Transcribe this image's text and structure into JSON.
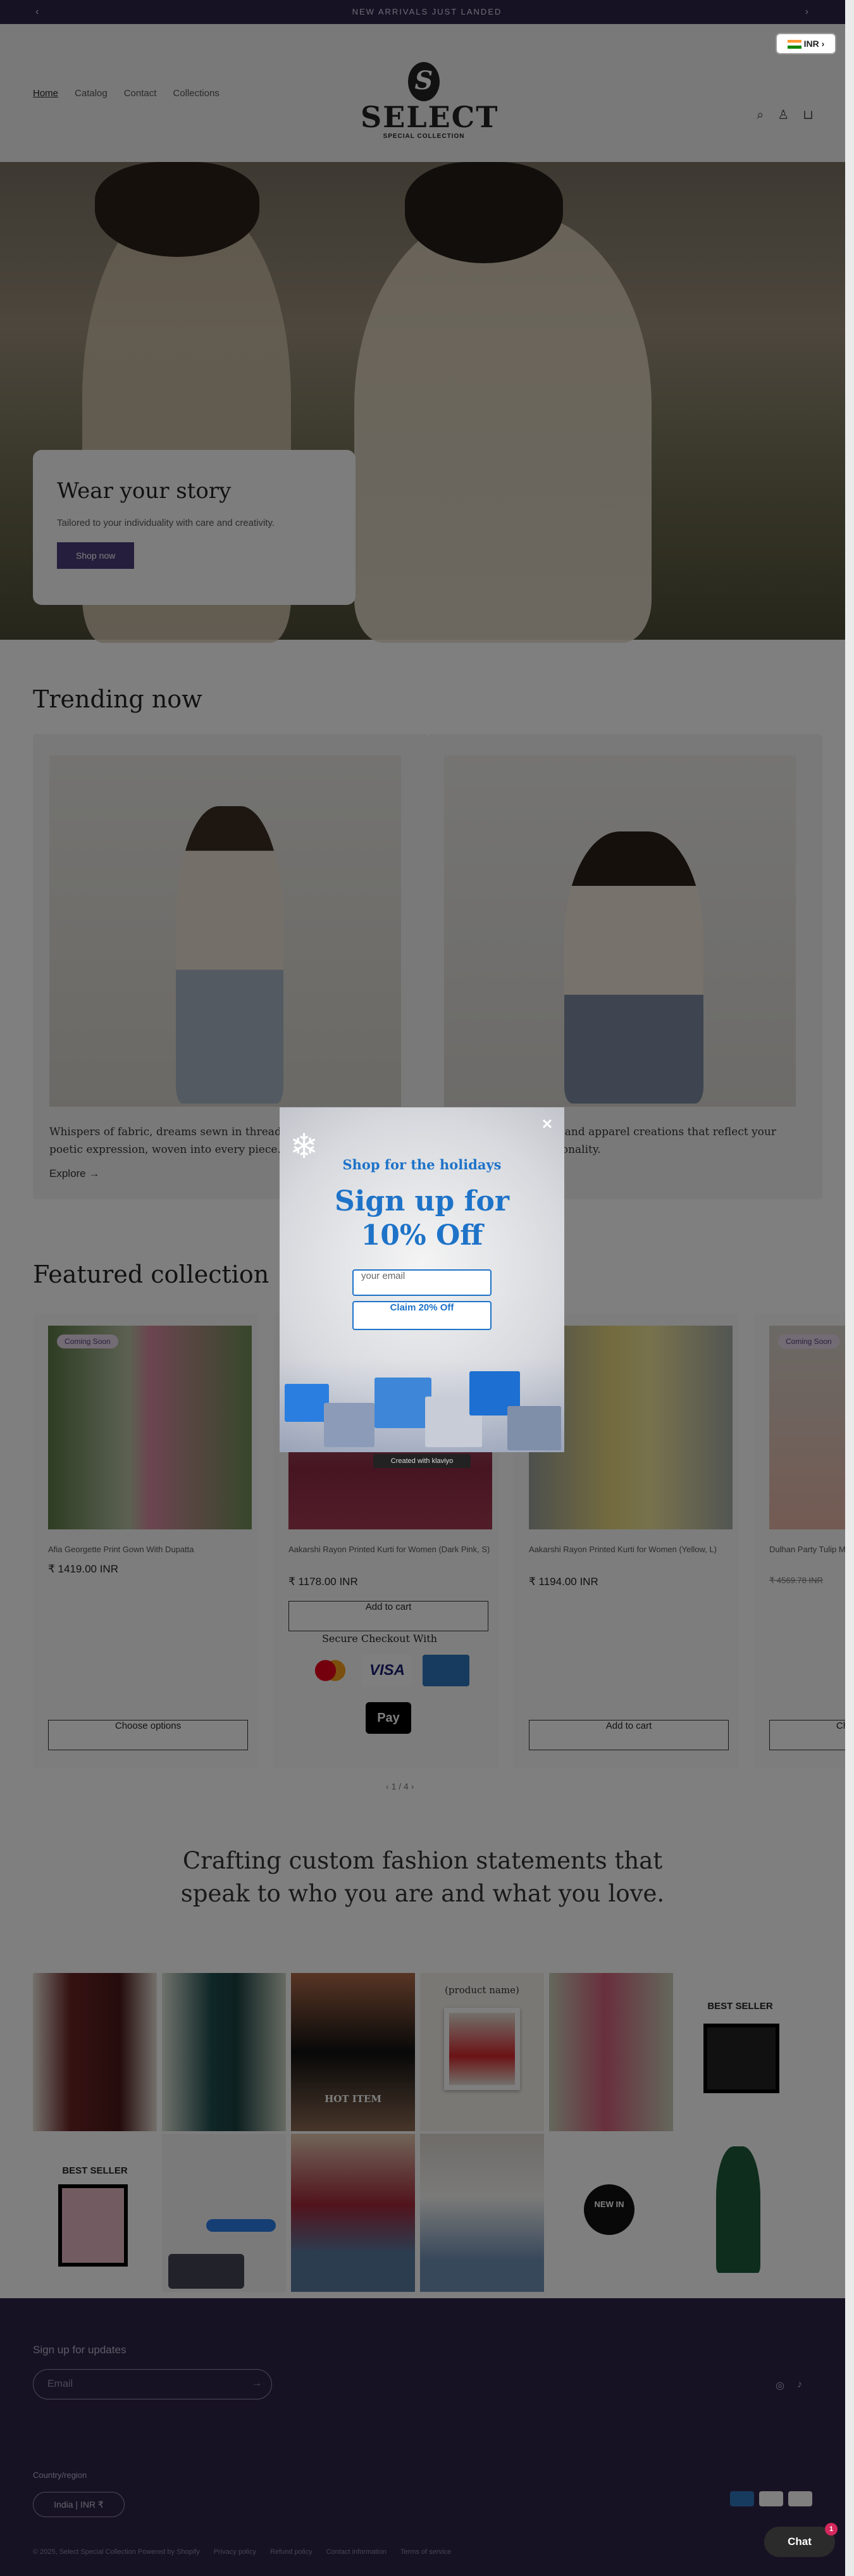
{
  "announcement": {
    "text": "NEW ARRIVALS JUST LANDED"
  },
  "header": {
    "nav": [
      "Home",
      "Catalog",
      "Contact",
      "Collections"
    ],
    "logo_letter": "S",
    "logo_word": "SELECT",
    "logo_sub": "SPECIAL COLLECTION",
    "currency": "INR"
  },
  "hero": {
    "title": "Wear your story",
    "subtitle": "Tailored to your individuality with care and creativity.",
    "button": "Shop now"
  },
  "trending": {
    "title": "Trending now",
    "cards": [
      {
        "text": "Whispers of fabric, dreams sewn in thread: our designs are a poetic expression, woven into every piece.",
        "link": "Explore →"
      },
      {
        "text": "Personalized clothing and apparel creations that reflect your unique style and personality.",
        "link": ""
      }
    ]
  },
  "featured": {
    "title": "Featured collection",
    "products": [
      {
        "badge": "Coming Soon",
        "name": "Afia Georgette Print Gown With Dupatta",
        "price": "₹ 1419.00 INR",
        "button": "Choose options"
      },
      {
        "badge": "",
        "name": "Aakarshi Rayon Printed Kurti for Women (Dark Pink, S)",
        "price": "₹ 1178.00 INR",
        "button": "Add to cart"
      },
      {
        "badge": "",
        "name": "Aakarshi Rayon Printed Kurti for Women (Yellow, L)",
        "price": "₹ 1194.00 INR",
        "button": "Add to cart"
      },
      {
        "badge": "Coming Soon",
        "name": "Dulhan Party Tulip Maxi Cocktail Dress",
        "price": "₹ 4569.78 INR",
        "button": "Choose options"
      }
    ],
    "secure_checkout": "Secure Checkout With",
    "apple_pay": " Pay",
    "pager": "1 / 4"
  },
  "statement": {
    "text": "Crafting custom fashion statements that speak to who you are and what you love."
  },
  "mosaic": {
    "labels": [
      "BEST SELLER",
      "(product name)",
      "BEST SELLER",
      "HOT ITEM",
      "NEW IN"
    ]
  },
  "footer": {
    "signup_title": "Sign up for updates",
    "email_placeholder": "Email",
    "country_title": "Country/region",
    "country_value": "India | INR ₹",
    "bottom_links": [
      "© 2025, Select Special Collection Powered by Shopify",
      "Privacy policy",
      "Refund policy",
      "Contact information",
      "Terms of service"
    ]
  },
  "popup": {
    "kicker": "Shop for the holidays",
    "headline": "Sign up for 10% Off",
    "email_placeholder": "your email",
    "cta": "Claim 20% Off",
    "created_with": "Created with klaviyo",
    "close": "✕"
  },
  "chat": {
    "label": "Chat",
    "count": "1"
  }
}
